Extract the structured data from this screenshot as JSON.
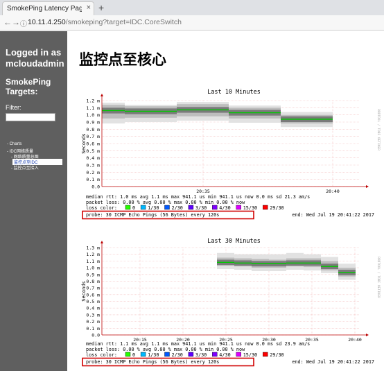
{
  "browser": {
    "tab_title": "SmokePing Latency Page for I",
    "tab_close": "×",
    "new_tab": "+",
    "url_host": "10.11.4.250",
    "url_path": "/smokeping?target=IDC.CoreSwitch",
    "back": "←",
    "forward": "→",
    "reload": "C",
    "info": "ⓘ"
  },
  "sidebar": {
    "logged_in": "Logged in as mcloudadmin",
    "targets_title": "SmokePing Targets:",
    "filter_label": "Filter:",
    "filter_value": "",
    "tree": [
      "- Charts",
      "- IDC网络质量",
      "- 网络质量总图",
      "监控点至IDC",
      "- 监控点至接入"
    ]
  },
  "page": {
    "title": "监控点至核心"
  },
  "colors": {
    "sidebar": "#5f5f5f",
    "median": "#00c800",
    "axis": "#bb0000",
    "probe_box": "#d00000"
  },
  "graphs": [
    {
      "title": "Last 10 Minutes",
      "ylabel": "Seconds",
      "side_label": "RRDTOOL / TOBI OETIKER",
      "y_ticks": [
        "0.0",
        "0.1 m",
        "0.2 m",
        "0.3 m",
        "0.4 m",
        "0.5 m",
        "0.6 m",
        "0.7 m",
        "0.8 m",
        "0.9 m",
        "1.0 m",
        "1.1 m",
        "1.2 m"
      ],
      "x_ticks": [
        "20:35",
        "20:40"
      ],
      "median_rtt": "median rtt:  1.0 ms avg  1.1 ms max  941.1 us min  941.1 us now  0.0 ms sd  21.3   am/s",
      "packet_loss": "packet loss: 0.00 % avg  0.00 % max  0.00 % min  0.00 % now",
      "loss_color_label": "loss color:",
      "probe": "probe:      30 ICMP Echo Pings (56 Bytes) every 120s",
      "end": "end: Wed Jul 19 20:41:22 2017"
    },
    {
      "title": "Last 30 Minutes",
      "ylabel": "Seconds",
      "side_label": "RRDTOOL / TOBI OETIKER",
      "y_ticks": [
        "0.0",
        "0.1 m",
        "0.2 m",
        "0.3 m",
        "0.4 m",
        "0.5 m",
        "0.6 m",
        "0.7 m",
        "0.8 m",
        "0.9 m",
        "1.0 m",
        "1.1 m",
        "1.2 m",
        "1.3 m"
      ],
      "x_ticks": [
        "20:15",
        "20:20",
        "20:25",
        "20:30",
        "20:35",
        "20:40"
      ],
      "median_rtt": "median rtt:  1.1 ms avg  1.1 ms max  941.1 us min  941.1 us now  0.0 ms sd  23.9   am/s",
      "packet_loss": "packet loss: 0.00 % avg  0.00 % max  0.00 % min  0.00 % now",
      "loss_color_label": "loss color:",
      "probe": "probe:      30 ICMP Echo Pings (56 Bytes) every 120s",
      "end": "end: Wed Jul 19 20:41:22 2017"
    }
  ],
  "loss_legend": [
    {
      "label": "0",
      "color": "#26ff00"
    },
    {
      "label": "1/30",
      "color": "#00b8ff"
    },
    {
      "label": "2/30",
      "color": "#0059ff"
    },
    {
      "label": "3/30",
      "color": "#5e00ff"
    },
    {
      "label": "4/30",
      "color": "#7e00ff"
    },
    {
      "label": "15/30",
      "color": "#dd00ff"
    },
    {
      "label": "29/30",
      "color": "#ff0000"
    }
  ]
}
